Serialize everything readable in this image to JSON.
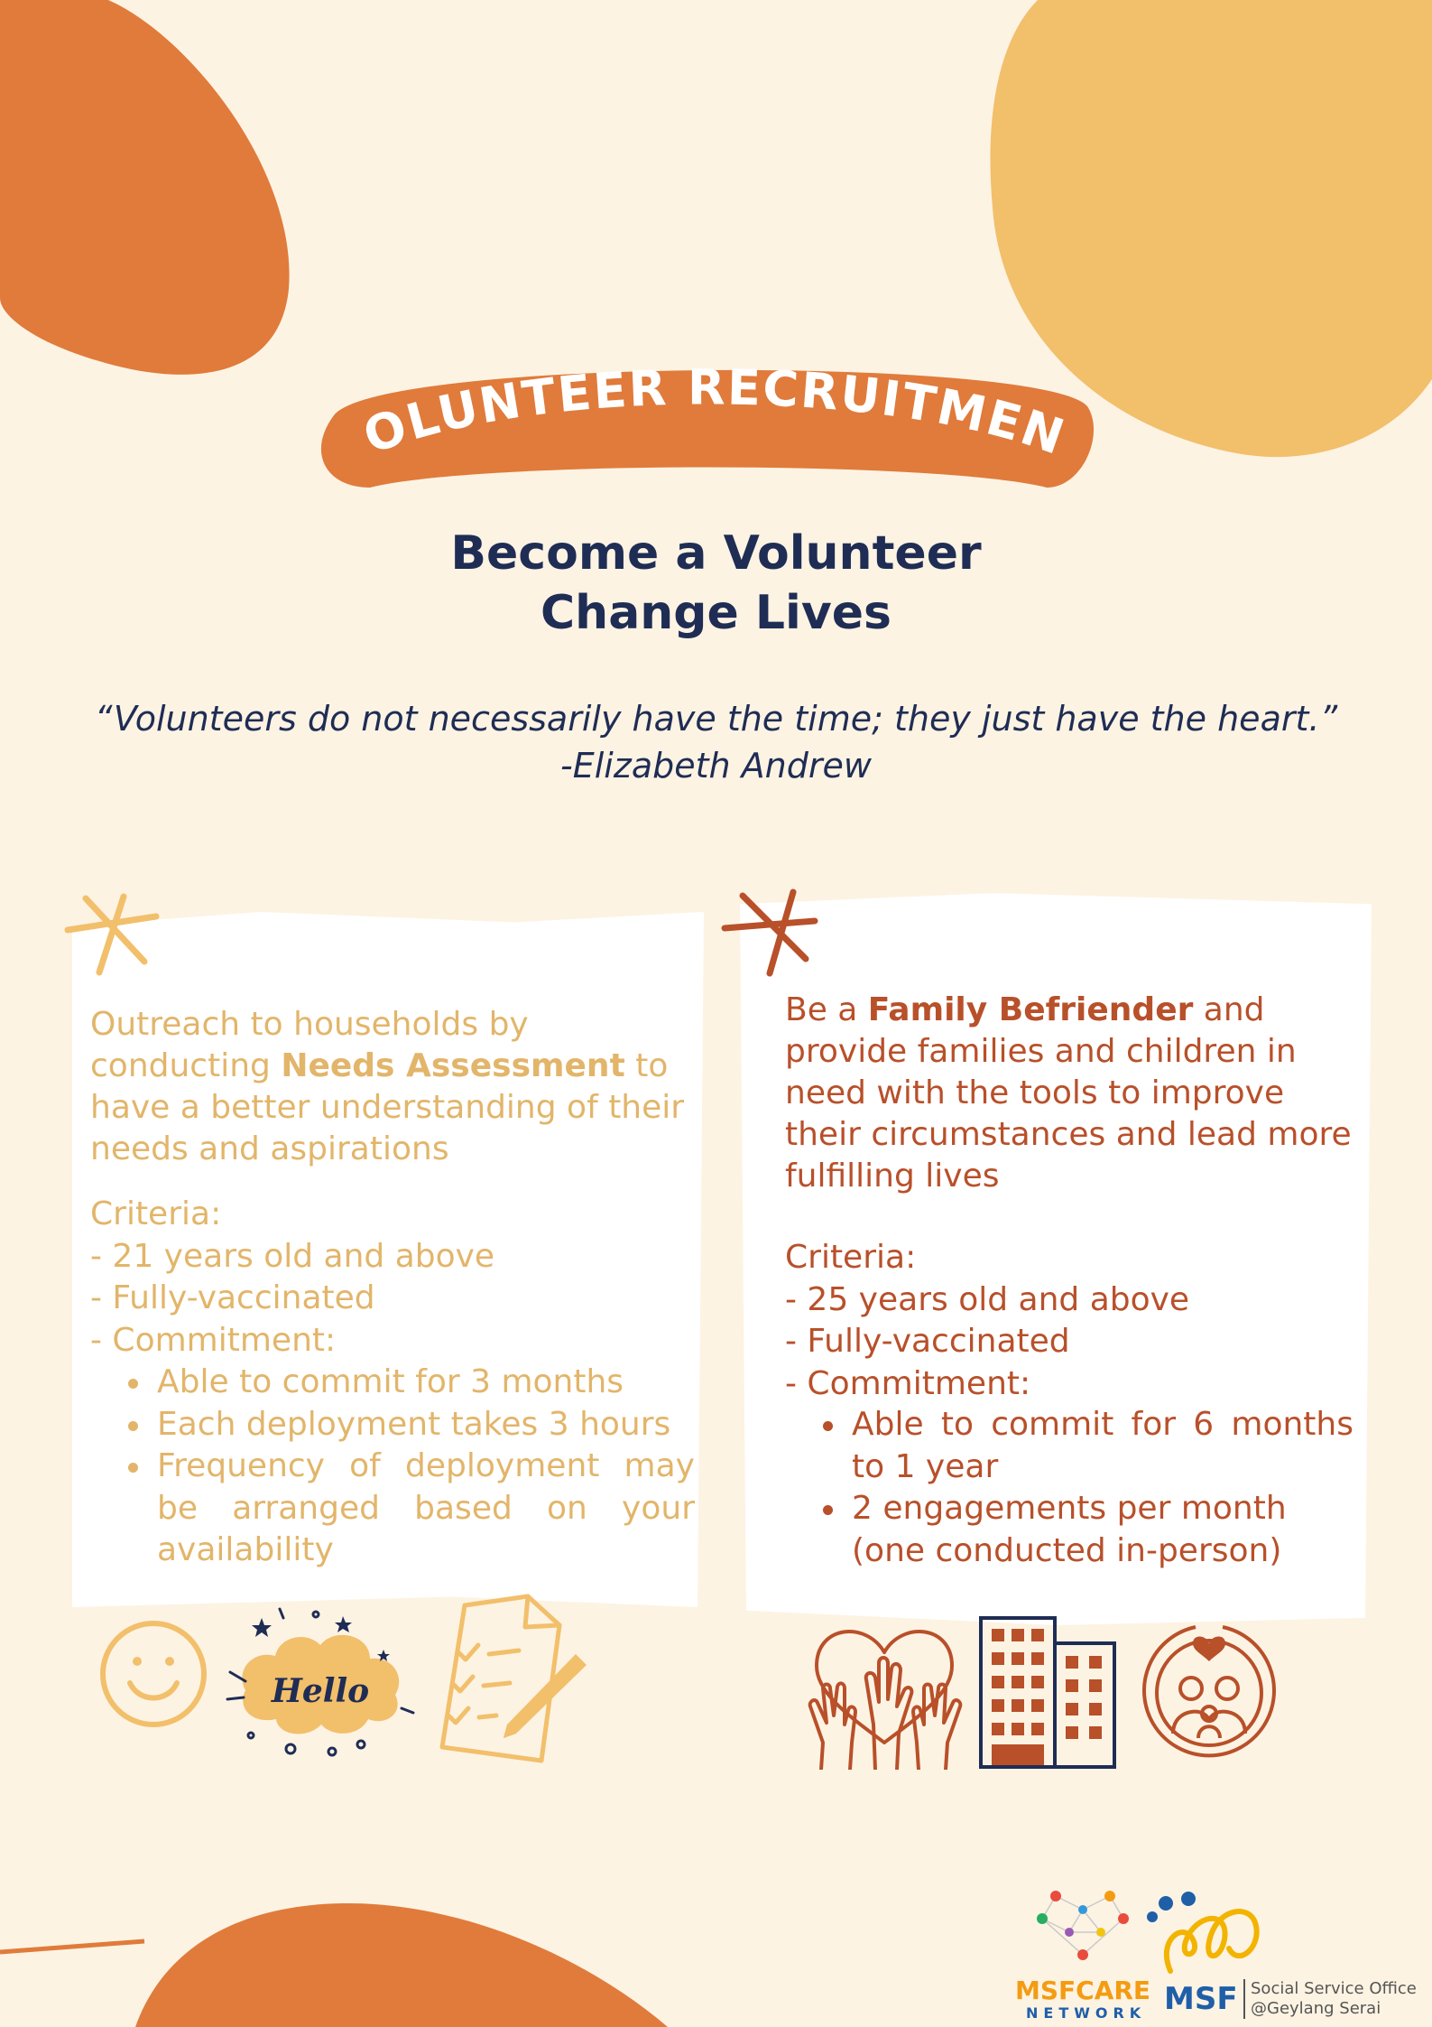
{
  "banner": {
    "title": "VOLUNTEER RECRUITMENT"
  },
  "headline": {
    "line1": "Become a Volunteer",
    "line2": "Change Lives"
  },
  "quote": {
    "text": "“Volunteers do not necessarily have the time; they just have the heart.”",
    "author": "-Elizabeth Andrew"
  },
  "left_card": {
    "intro_before": "Outreach to households by conducting ",
    "intro_bold": "Needs Assessment",
    "intro_after": " to have a better understanding of their needs and aspirations",
    "criteria_title": "Criteria:",
    "criteria": [
      "- 21 years old and above",
      "- Fully-vaccinated",
      "- Commitment:"
    ],
    "commitments": [
      "Able to commit for 3 months",
      "Each deployment takes 3 hours",
      "Frequency of deployment may be arranged based on your availability"
    ],
    "hello_text": "Hello"
  },
  "right_card": {
    "intro_before": "Be a ",
    "intro_bold": "Family Befriender",
    "intro_after": " and provide families and children in need with the tools to improve their circumstances and lead more fulfilling lives",
    "criteria_title": "Criteria:",
    "criteria": [
      "- 25 years old and above",
      "- Fully-vaccinated",
      "- Commitment:"
    ],
    "commitments": [
      "Able to commit for 6 months to 1 year",
      "2 engagements per month (one conducted in-person)"
    ]
  },
  "logos": {
    "msf_care_line1": "MSFCARE",
    "msf_care_line2": "NETWORK",
    "msf_label": "MSF",
    "sso_line1": "Social Service Office",
    "sso_line2": "@Geylang Serai"
  },
  "colors": {
    "background": "#fdf3e3",
    "orange": "#e07b3b",
    "gold": "#f2bf6b",
    "navy": "#1f2d55",
    "left_text": "#e2b56a",
    "right_text": "#b8502a"
  },
  "icons": [
    "star-asterisk-icon",
    "smiley-face-icon",
    "hello-cloud-icon",
    "checklist-pen-icon",
    "raised-hands-heart-icon",
    "buildings-icon",
    "family-heart-icon"
  ]
}
